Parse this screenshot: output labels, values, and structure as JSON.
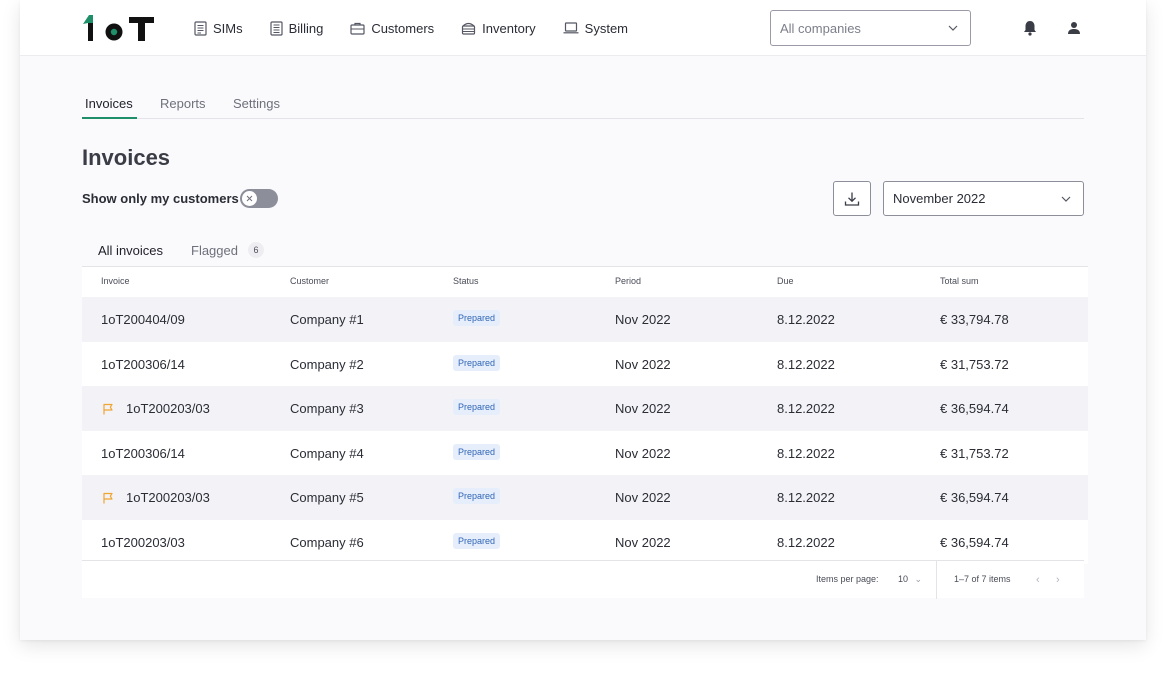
{
  "logo": {
    "text": "1oT"
  },
  "nav": {
    "items": [
      {
        "label": "SIMs",
        "icon": "sim-list-icon"
      },
      {
        "label": "Billing",
        "icon": "billing-doc-icon"
      },
      {
        "label": "Customers",
        "icon": "briefcase-icon"
      },
      {
        "label": "Inventory",
        "icon": "inventory-box-icon"
      },
      {
        "label": "System",
        "icon": "laptop-icon"
      }
    ]
  },
  "company_select": {
    "value": "All companies"
  },
  "subtabs": [
    {
      "label": "Invoices",
      "active": true
    },
    {
      "label": "Reports",
      "active": false
    },
    {
      "label": "Settings",
      "active": false
    }
  ],
  "page": {
    "title": "Invoices"
  },
  "filters": {
    "toggle_label": "Show only my customers",
    "toggle_on": false,
    "period": "November 2022"
  },
  "invoice_tabs": {
    "all": "All invoices",
    "flagged": "Flagged",
    "flagged_count": "6"
  },
  "table": {
    "headers": [
      "Invoice",
      "Customer",
      "Status",
      "Period",
      "Due",
      "Total sum"
    ],
    "rows": [
      {
        "invoice": "1oT200404/09",
        "flagged": false,
        "customer": "Company #1",
        "status": "Prepared",
        "period": "Nov 2022",
        "due": "8.12.2022",
        "total": "€ 33,794.78"
      },
      {
        "invoice": "1oT200306/14",
        "flagged": false,
        "customer": "Company #2",
        "status": "Prepared",
        "period": "Nov 2022",
        "due": "8.12.2022",
        "total": "€ 31,753.72"
      },
      {
        "invoice": "1oT200203/03",
        "flagged": true,
        "customer": "Company #3",
        "status": "Prepared",
        "period": "Nov 2022",
        "due": "8.12.2022",
        "total": "€ 36,594.74"
      },
      {
        "invoice": "1oT200306/14",
        "flagged": false,
        "customer": "Company #4",
        "status": "Prepared",
        "period": "Nov 2022",
        "due": "8.12.2022",
        "total": "€ 31,753.72"
      },
      {
        "invoice": "1oT200203/03",
        "flagged": true,
        "customer": "Company #5",
        "status": "Prepared",
        "period": "Nov 2022",
        "due": "8.12.2022",
        "total": "€ 36,594.74"
      },
      {
        "invoice": "1oT200203/03",
        "flagged": false,
        "customer": "Company #6",
        "status": "Prepared",
        "period": "Nov 2022",
        "due": "8.12.2022",
        "total": "€ 36,594.74"
      }
    ]
  },
  "pagination": {
    "items_per_page_label": "Items per page:",
    "items_per_page": "10",
    "range": "1–7 of 7 items"
  },
  "colors": {
    "accent": "#1f8f6a",
    "flag": "#f0a431",
    "status_badge_bg": "#e6eefb",
    "status_badge_text": "#3267b7"
  }
}
